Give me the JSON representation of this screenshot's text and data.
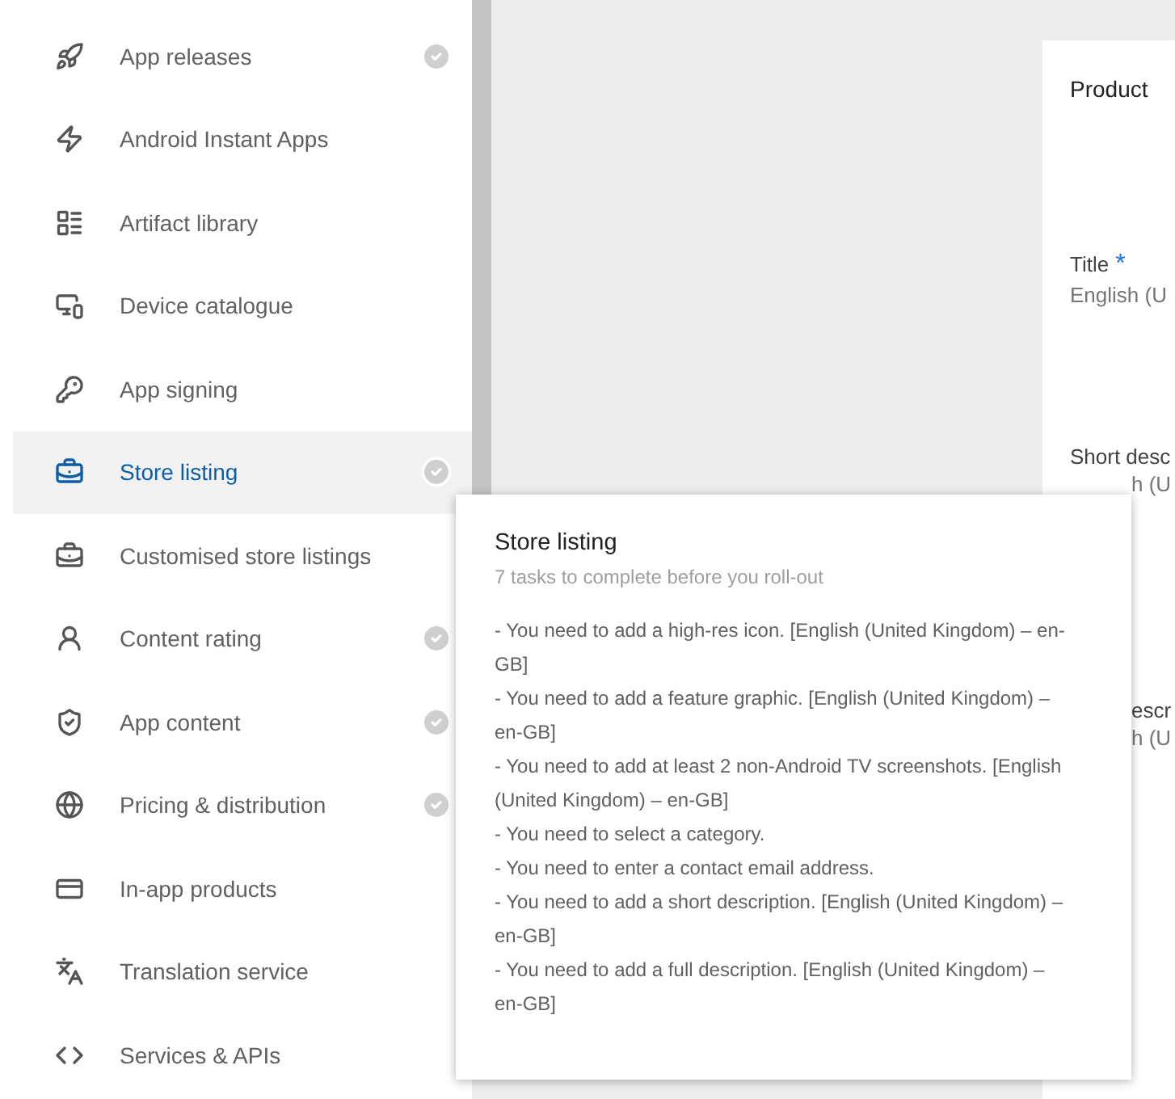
{
  "sidebar": {
    "items": [
      {
        "label": "App releases",
        "done": true,
        "selected": false
      },
      {
        "label": "Android Instant Apps",
        "done": false,
        "selected": false
      },
      {
        "label": "Artifact library",
        "done": false,
        "selected": false
      },
      {
        "label": "Device catalogue",
        "done": false,
        "selected": false
      },
      {
        "label": "App signing",
        "done": false,
        "selected": false
      },
      {
        "label": "Store listing",
        "done": true,
        "selected": true
      },
      {
        "label": "Customised store listings",
        "done": false,
        "selected": false
      },
      {
        "label": "Content rating",
        "done": true,
        "selected": false
      },
      {
        "label": "App content",
        "done": true,
        "selected": false
      },
      {
        "label": "Pricing & distribution",
        "done": true,
        "selected": false
      },
      {
        "label": "In-app products",
        "done": false,
        "selected": false
      },
      {
        "label": "Translation service",
        "done": false,
        "selected": false
      },
      {
        "label": "Services & APIs",
        "done": false,
        "selected": false
      }
    ]
  },
  "card": {
    "heading": "Product",
    "fields": [
      {
        "label": "Title",
        "required_mark": "*",
        "hint": "English (U"
      },
      {
        "label": "Short desc",
        "hint": "h (U"
      },
      {
        "label": "escr",
        "hint": "h (U"
      }
    ]
  },
  "popup": {
    "title": "Store listing",
    "subtitle": "7 tasks to complete before you roll-out",
    "tasks": [
      "- You need to add a high-res icon. [English (United Kingdom) – en-GB]",
      "- You need to add a feature graphic. [English (United Kingdom) – en-GB]",
      "- You need to add at least 2 non-Android TV screenshots. [English (United Kingdom) – en-GB]",
      "- You need to select a category.",
      "- You need to enter a contact email address.",
      "- You need to add a short description. [English (United Kingdom) – en-GB]",
      "- You need to add a full description. [English (United Kingdom) – en-GB]"
    ]
  }
}
